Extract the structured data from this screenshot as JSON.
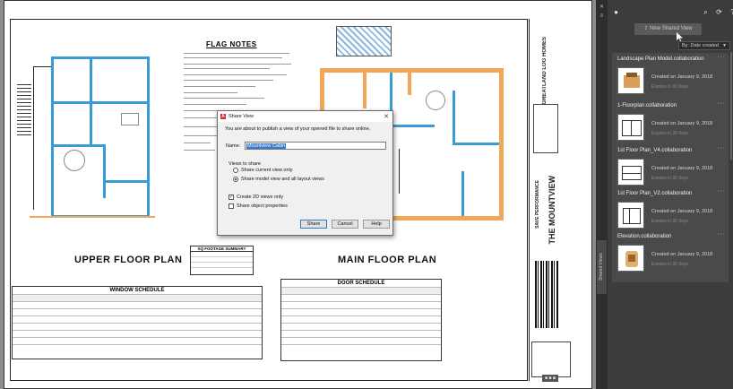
{
  "dialog": {
    "title": "Share View",
    "description": "You are about to publish a view of your opened file to share online.",
    "name_label": "Name:",
    "name_value": "Mountview Cabin",
    "views_label": "Views to share",
    "option_current": "Share current view only",
    "option_model": "Share model view and all layout views",
    "check_2d": "Create 2D views only",
    "check_props": "Share object properties",
    "share_button": "Share",
    "cancel_button": "Cancel",
    "help_button": "Help",
    "close_glyph": "✕",
    "selected_option": "option_model",
    "create_2d_checked": true,
    "share_properties_checked": false
  },
  "drawing": {
    "flag_notes_title": "FLAG NOTES",
    "upper_plan_title": "UPPER FLOOR PLAN",
    "main_plan_title": "MAIN FLOOR PLAN",
    "window_schedule_title": "WINDOW SCHEDULE",
    "door_schedule_title": "DOOR SCHEDULE",
    "sq_footage_title": "SQ FOOTAGE SUMMARY",
    "titleblock_company": "GREATLAND LOG HOMES",
    "titleblock_project": "THE MOUNTVIEW",
    "titleblock_status": "SAVE PERFORMANCE"
  },
  "panel": {
    "new_view_label": "New Shared View",
    "sort_label": "By: Date created",
    "cards": [
      {
        "title": "Landscape Plan Model.collaboration",
        "created": "Created on January 9, 2018",
        "expires": "Expires in 30 days"
      },
      {
        "title": "1-Floorplan.collaboration",
        "created": "Created on January 9, 2018",
        "expires": "Expires in 30 days"
      },
      {
        "title": "1st Floor Plan_V4.collaboration",
        "created": "Created on January 9, 2018",
        "expires": "Expires in 30 days"
      },
      {
        "title": "1st Floor Plan_V2.collaboration",
        "created": "Created on January 9, 2018",
        "expires": "Expires in 30 days"
      },
      {
        "title": "Elevation.collaboration",
        "created": "Created on January 9, 2018",
        "expires": "Expires in 30 days"
      }
    ],
    "side_tab": "Shared Views"
  },
  "colors": {
    "accent": "#3b9bd6",
    "log_wall": "#f2a65a",
    "panel_bg": "#3c3c3c"
  }
}
